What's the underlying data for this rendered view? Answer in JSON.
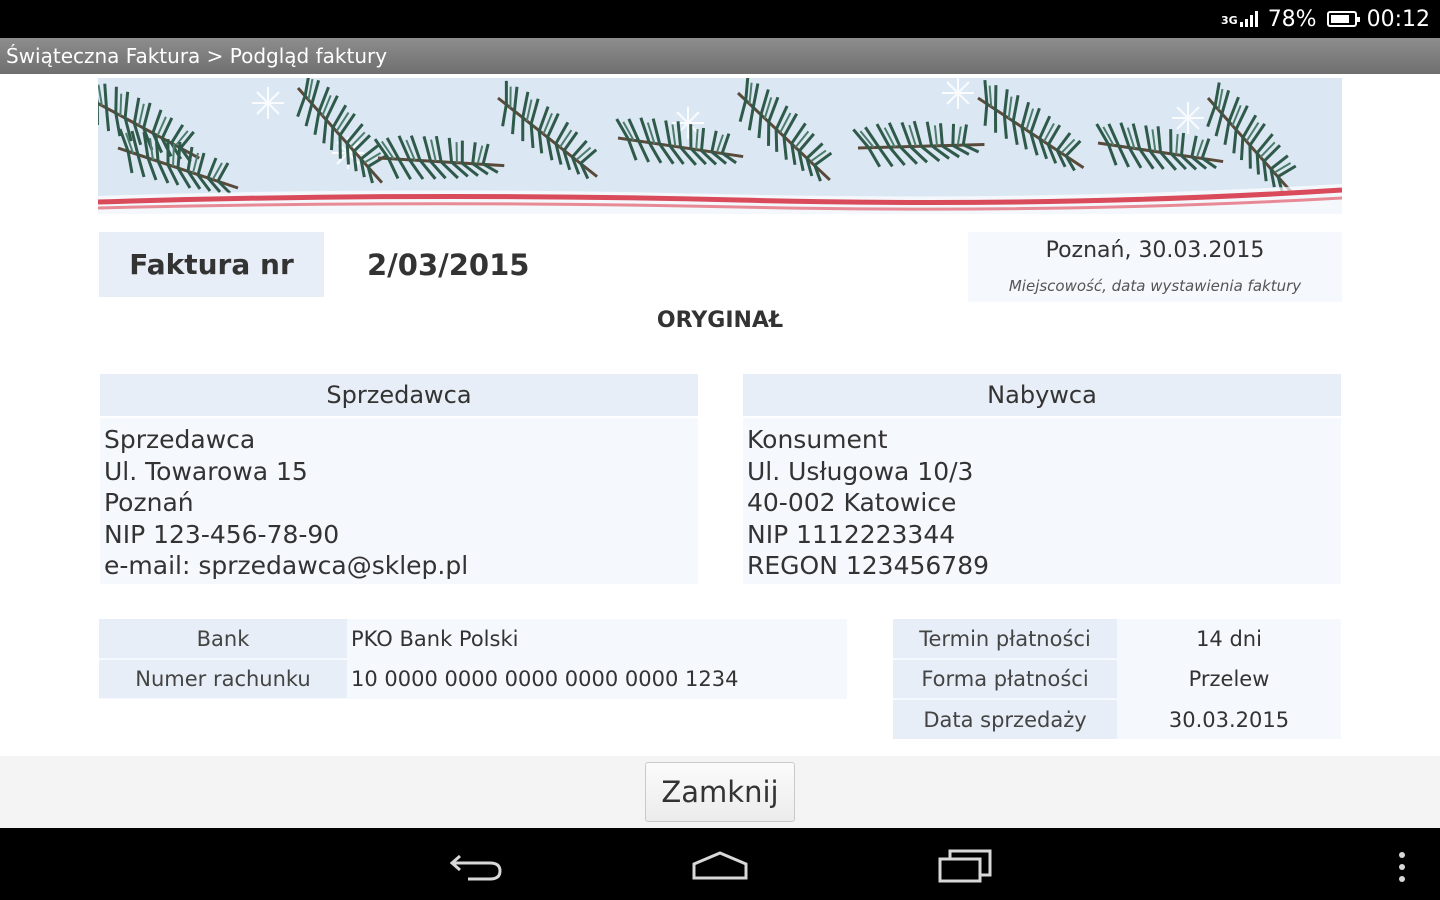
{
  "status": {
    "battery": "78%",
    "time": "00:12",
    "network": "3G"
  },
  "appbar": {
    "breadcrumb": "Świąteczna Faktura > Podgląd faktury"
  },
  "invoice": {
    "number_label": "Faktura nr",
    "number": "2/03/2015",
    "place_date": "Poznań, 30.03.2015",
    "place_date_caption": "Miejscowość, data wystawienia faktury",
    "copy_type": "ORYGINAŁ"
  },
  "seller": {
    "header": "Sprzedawca",
    "lines": [
      "Sprzedawca",
      "Ul. Towarowa 15",
      "Poznań",
      "NIP 123-456-78-90",
      "e-mail: sprzedawca@sklep.pl"
    ]
  },
  "buyer": {
    "header": "Nabywca",
    "lines": [
      "Konsument",
      "Ul. Usługowa 10/3",
      "40-002 Katowice",
      "NIP 1112223344",
      "REGON 123456789"
    ]
  },
  "bank": {
    "rows": [
      {
        "label": "Bank",
        "value": "PKO Bank Polski"
      },
      {
        "label": "Numer rachunku",
        "value": "10 0000 0000 0000 0000 0000 1234"
      }
    ]
  },
  "payment": {
    "rows": [
      {
        "label": "Termin płatności",
        "value": "14 dni"
      },
      {
        "label": "Forma płatności",
        "value": "Przelew"
      },
      {
        "label": "Data sprzedaży",
        "value": "30.03.2015"
      }
    ]
  },
  "actions": {
    "close_label": "Zamknij"
  },
  "colors": {
    "header_bg": "#e8eef7",
    "banner_ribbon": "#d94a5a",
    "pine": "#2f5a4a"
  }
}
